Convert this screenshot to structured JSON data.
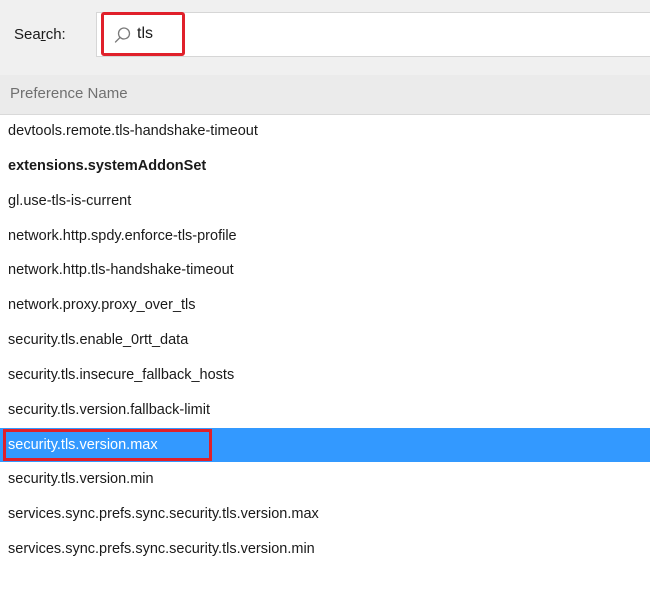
{
  "search": {
    "label_before": "Sea",
    "label_accel": "r",
    "label_after": "ch:",
    "value": "tls",
    "icon": "search-icon"
  },
  "table": {
    "column_header": "Preference Name",
    "rows": [
      {
        "name": "devtools.remote.tls-handshake-timeout",
        "bold": false,
        "selected": false
      },
      {
        "name": "extensions.systemAddonSet",
        "bold": true,
        "selected": false
      },
      {
        "name": "gl.use-tls-is-current",
        "bold": false,
        "selected": false
      },
      {
        "name": "network.http.spdy.enforce-tls-profile",
        "bold": false,
        "selected": false
      },
      {
        "name": "network.http.tls-handshake-timeout",
        "bold": false,
        "selected": false
      },
      {
        "name": "network.proxy.proxy_over_tls",
        "bold": false,
        "selected": false
      },
      {
        "name": "security.tls.enable_0rtt_data",
        "bold": false,
        "selected": false
      },
      {
        "name": "security.tls.insecure_fallback_hosts",
        "bold": false,
        "selected": false
      },
      {
        "name": "security.tls.version.fallback-limit",
        "bold": false,
        "selected": false
      },
      {
        "name": "security.tls.version.max",
        "bold": false,
        "selected": true
      },
      {
        "name": "security.tls.version.min",
        "bold": false,
        "selected": false
      },
      {
        "name": "services.sync.prefs.sync.security.tls.version.max",
        "bold": false,
        "selected": false
      },
      {
        "name": "services.sync.prefs.sync.security.tls.version.min",
        "bold": false,
        "selected": false
      }
    ]
  },
  "colors": {
    "selection": "#3399ff",
    "highlight_annotation": "#e0202a"
  }
}
